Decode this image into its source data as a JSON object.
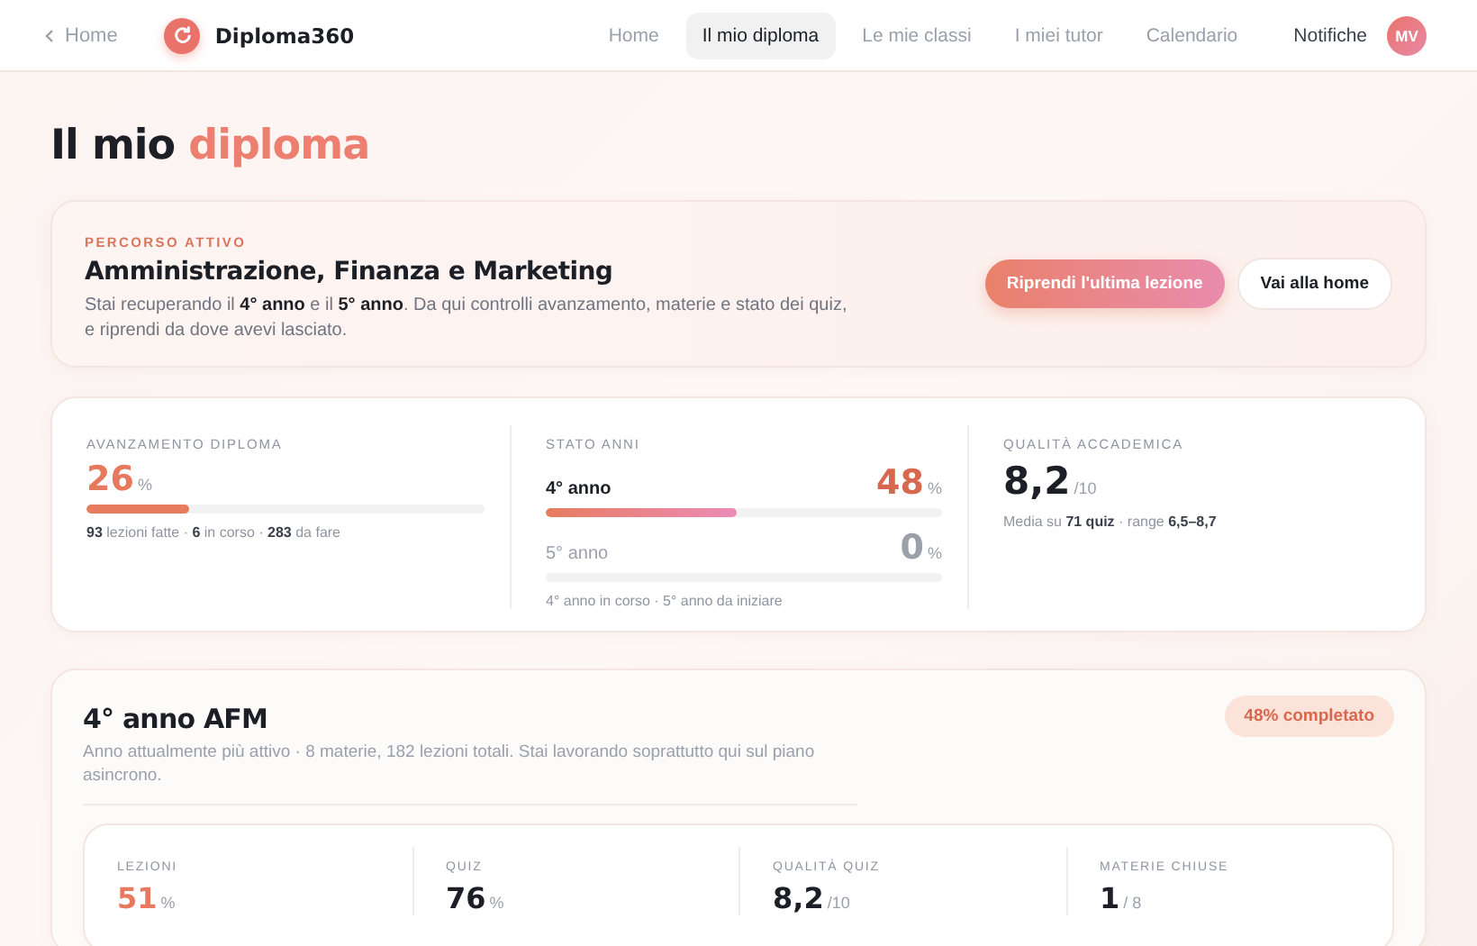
{
  "header": {
    "back": "Home",
    "brand": "Diploma360",
    "nav": [
      {
        "label": "Home",
        "selected": false
      },
      {
        "label": "Il mio diploma",
        "selected": true
      },
      {
        "label": "Le mie classi",
        "selected": false
      },
      {
        "label": "I miei tutor",
        "selected": false
      },
      {
        "label": "Calendario",
        "selected": false
      }
    ],
    "notifications": "Notifiche",
    "avatar": "MV"
  },
  "page_title": {
    "text": "Il mio",
    "highlight": "diploma"
  },
  "active_path": {
    "eyebrow": "PERCORSO ATTIVO",
    "title": "Amministrazione, Finanza e Marketing",
    "description": "Stai recuperando il **4° anno** e il **5° anno**. Da qui controlli avanzamento, materie e stato dei quiz, e riprendi da dove avevi lasciato.",
    "primary_button": "Riprendi l'ultima lezione",
    "secondary_button": "Vai alla home"
  },
  "overview": {
    "progress": {
      "label": "AVANZAMENTO DIPLOMA",
      "value": "26",
      "unit": "%",
      "level": 0.26,
      "summary": "**93** lezioni fatte · **6** in corso · **283** da fare"
    },
    "years": {
      "label": "STATO ANNI",
      "items": [
        {
          "name": "4° anno",
          "value": "48",
          "unit": "%",
          "level": 0.48,
          "active": true
        },
        {
          "name": "5° anno",
          "value": "0",
          "unit": "%",
          "level": 0,
          "active": false
        }
      ],
      "note": "4° anno in corso · 5° anno da iniziare"
    },
    "quality": {
      "label": "QUALITÀ ACCADEMICA",
      "value": "8,2",
      "unit": "/10",
      "summary": "Media su **71 quiz** · range **6,5–8,7**"
    }
  },
  "year_detail": {
    "title": "4° anno AFM",
    "badge": "48% completato",
    "description": "Anno attualmente più attivo · 8 materie, 182 lezioni totali. Stai lavorando soprattutto qui sul piano asincrono.",
    "stats": [
      {
        "label": "LEZIONI",
        "value": "51",
        "unit": "%",
        "accent": true
      },
      {
        "label": "QUIZ",
        "value": "76",
        "unit": "%",
        "accent": false
      },
      {
        "label": "QUALITÀ QUIZ",
        "value": "8,2",
        "unit": "/10",
        "accent": false
      },
      {
        "label": "MATERIE CHIUSE",
        "value": "1",
        "unit": "/ 8",
        "accent": false
      }
    ]
  }
}
